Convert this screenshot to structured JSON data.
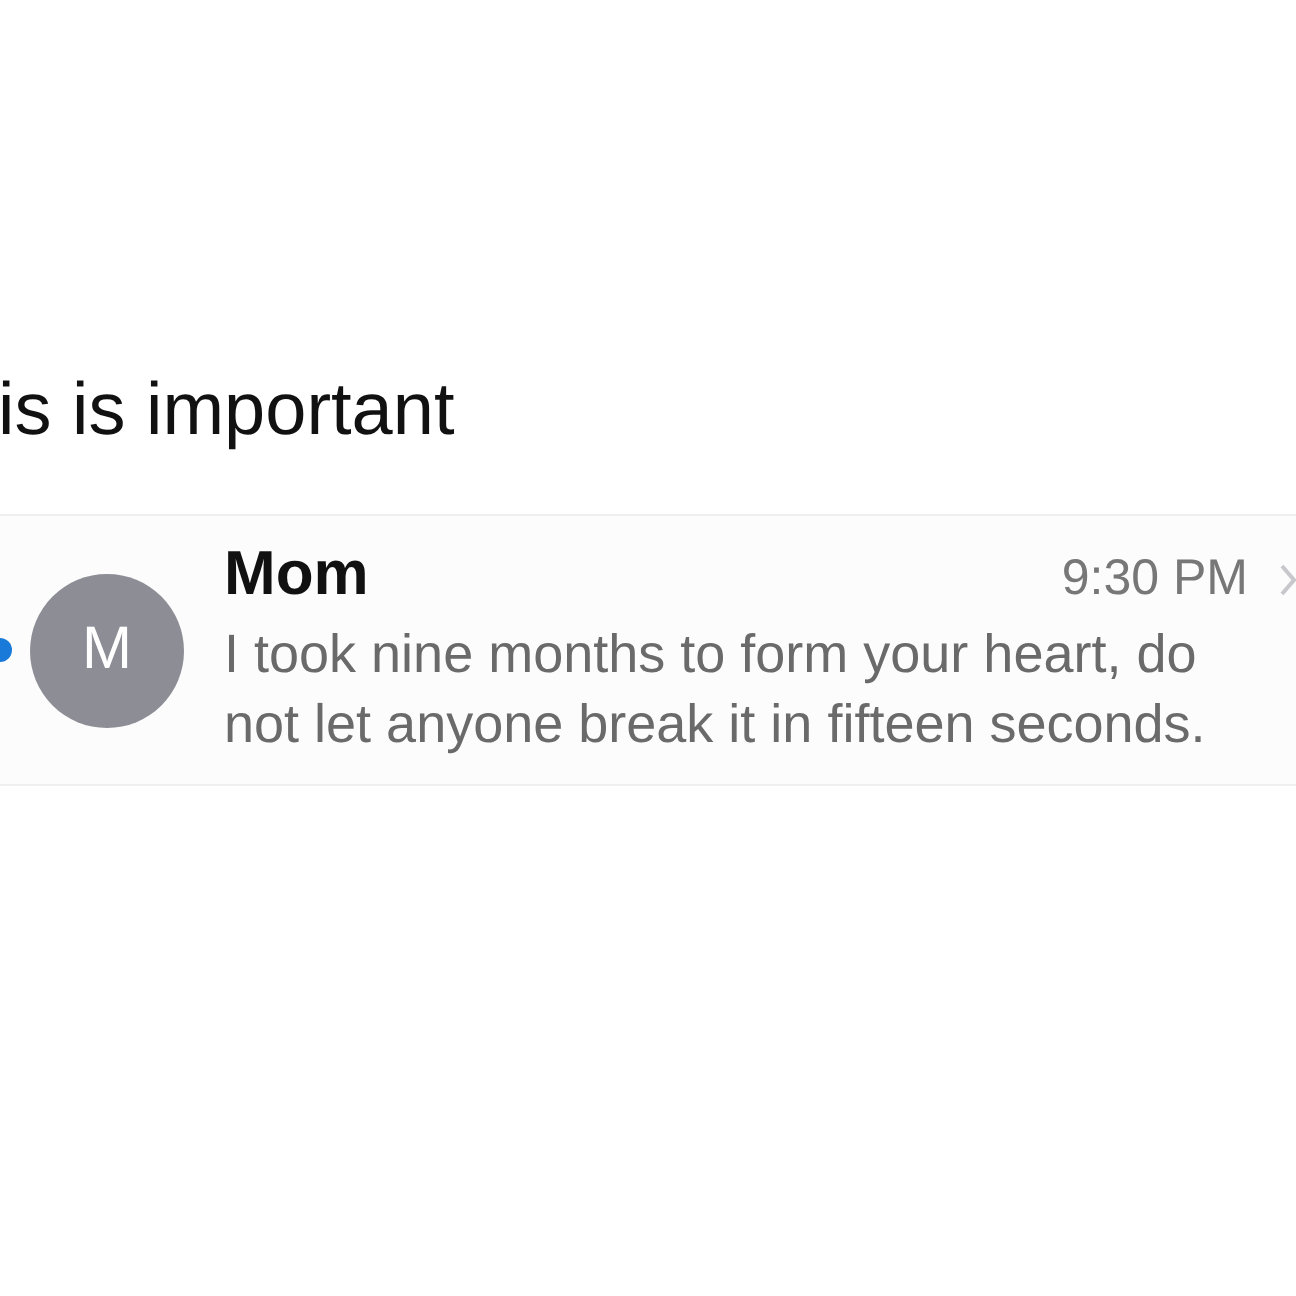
{
  "heading": "is is important",
  "message": {
    "unread": true,
    "avatar_letter": "M",
    "sender": "Mom",
    "time": "9:30 PM",
    "preview": "I took nine months to form your heart, do not let anyone break it in fifteen seconds."
  }
}
